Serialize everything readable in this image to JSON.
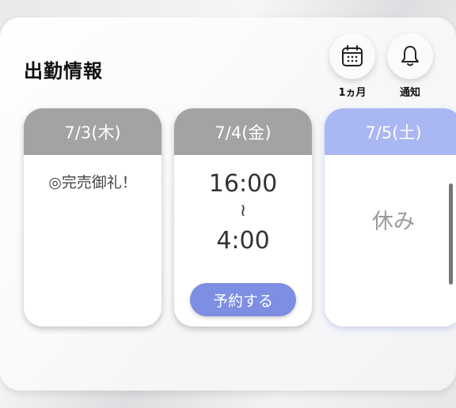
{
  "header": {
    "title": "出勤情報",
    "calendar_label": "1ヵ月",
    "notice_label": "通知"
  },
  "days": [
    {
      "date": "7/3(木)",
      "note": "◎完売御礼！",
      "status": "sold-out"
    },
    {
      "date": "7/4(金)",
      "start": "16:00",
      "separator": "≀",
      "end": "4:00",
      "action": "予約する",
      "status": "available"
    },
    {
      "date": "7/5(土)",
      "note": "休み",
      "status": "day-off"
    }
  ],
  "colors": {
    "weekday_header": "#a3a3a3",
    "saturday_header": "#a9b7f2",
    "reserve_button": "#7d8ee3"
  },
  "icons": {
    "calendar": "calendar-icon",
    "notice": "bell-icon"
  }
}
